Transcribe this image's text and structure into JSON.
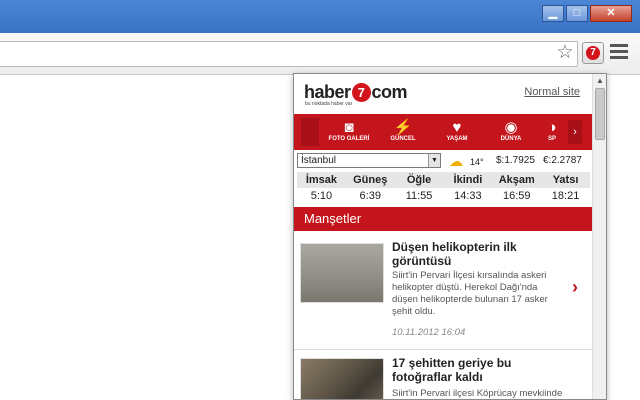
{
  "window": {
    "minimize_glyph": "▁",
    "maximize_glyph": "□",
    "close_glyph": "✕"
  },
  "toolbar": {
    "star_glyph": "☆",
    "ext_glyph": "7"
  },
  "popup": {
    "logo_left": "haber",
    "logo_seven": "7",
    "logo_right": "com",
    "tagline": "bu noktada haber var",
    "normal_site": "Normal site",
    "categories": [
      {
        "label": "FOTO GALERİ",
        "icon": "camera-icon",
        "glyph": "◙"
      },
      {
        "label": "GÜNCEL",
        "icon": "lightning-icon",
        "glyph": "⚡"
      },
      {
        "label": "YAŞAM",
        "icon": "heart-icon",
        "glyph": "♥"
      },
      {
        "label": "DÜNYA",
        "icon": "globe-icon",
        "glyph": "◉"
      },
      {
        "label": "SP",
        "icon": "sport-icon",
        "glyph": "◑"
      }
    ],
    "nav_right": "›",
    "city": "İstanbul",
    "city_arrow": "▼",
    "weather_glyph": "☁",
    "temp": "14°",
    "usd": "$:1.7925",
    "eur": "€:2.2787",
    "prayer_headers": [
      "İmsak",
      "Güneş",
      "Öğle",
      "İkindi",
      "Akşam",
      "Yatsı"
    ],
    "prayer_times": [
      "5:10",
      "6:39",
      "11:55",
      "14:33",
      "16:59",
      "18:21"
    ],
    "section_title": "Manşetler",
    "news": [
      {
        "title": "Düşen helikopterin ilk görüntüsü",
        "desc": "Siirt'in Pervari İlçesi kırsalında askeri helikopter düştü. Herekol Dağı'nda düşen helikopterde bulunan 17 asker şehit oldu.",
        "date": "10.11.2012 16:04",
        "chev": "›"
      },
      {
        "title": "17 şehitten geriye bu fotoğraflar kaldı",
        "desc": "Siirt'in Pervari ilçesi Köprücay mevkiinde",
        "date": "",
        "chev": ""
      }
    ],
    "scroll_up": "▲"
  },
  "colors": {
    "brand_red": "#c4141c",
    "titlebar_blue": "#3a72c4"
  }
}
